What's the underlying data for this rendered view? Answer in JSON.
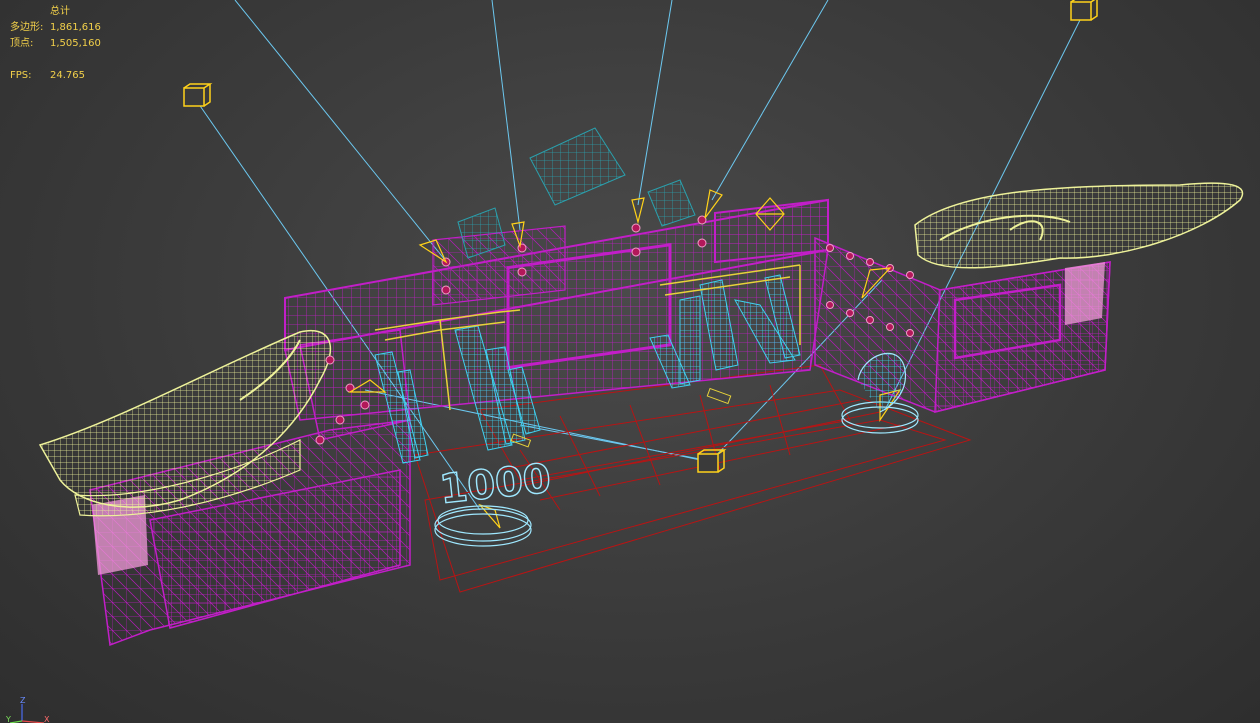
{
  "stats": {
    "header": "总计",
    "polygons_label": "多边形:",
    "polygons_value": "1,861,616",
    "vertices_label": "顶点:",
    "vertices_value": "1,505,160",
    "fps_label": "FPS:",
    "fps_value": "24.765"
  },
  "axis_gizmo": {
    "z_label": "Z",
    "x_label": "X",
    "y_label": "Y"
  },
  "colors": {
    "stats_text": "#f2d04a",
    "truss": "#c21ec8",
    "panel_blue": "#3fd0f0",
    "wing_yellow": "#eef29a",
    "floor_red": "#b81414",
    "light_beam": "#6cc8f0",
    "light_box": "#ffd21a"
  },
  "scene": {
    "sign_text": "1000",
    "icons": [
      "camera-target-icon",
      "spotlight-icon",
      "light-beam-icon"
    ]
  }
}
